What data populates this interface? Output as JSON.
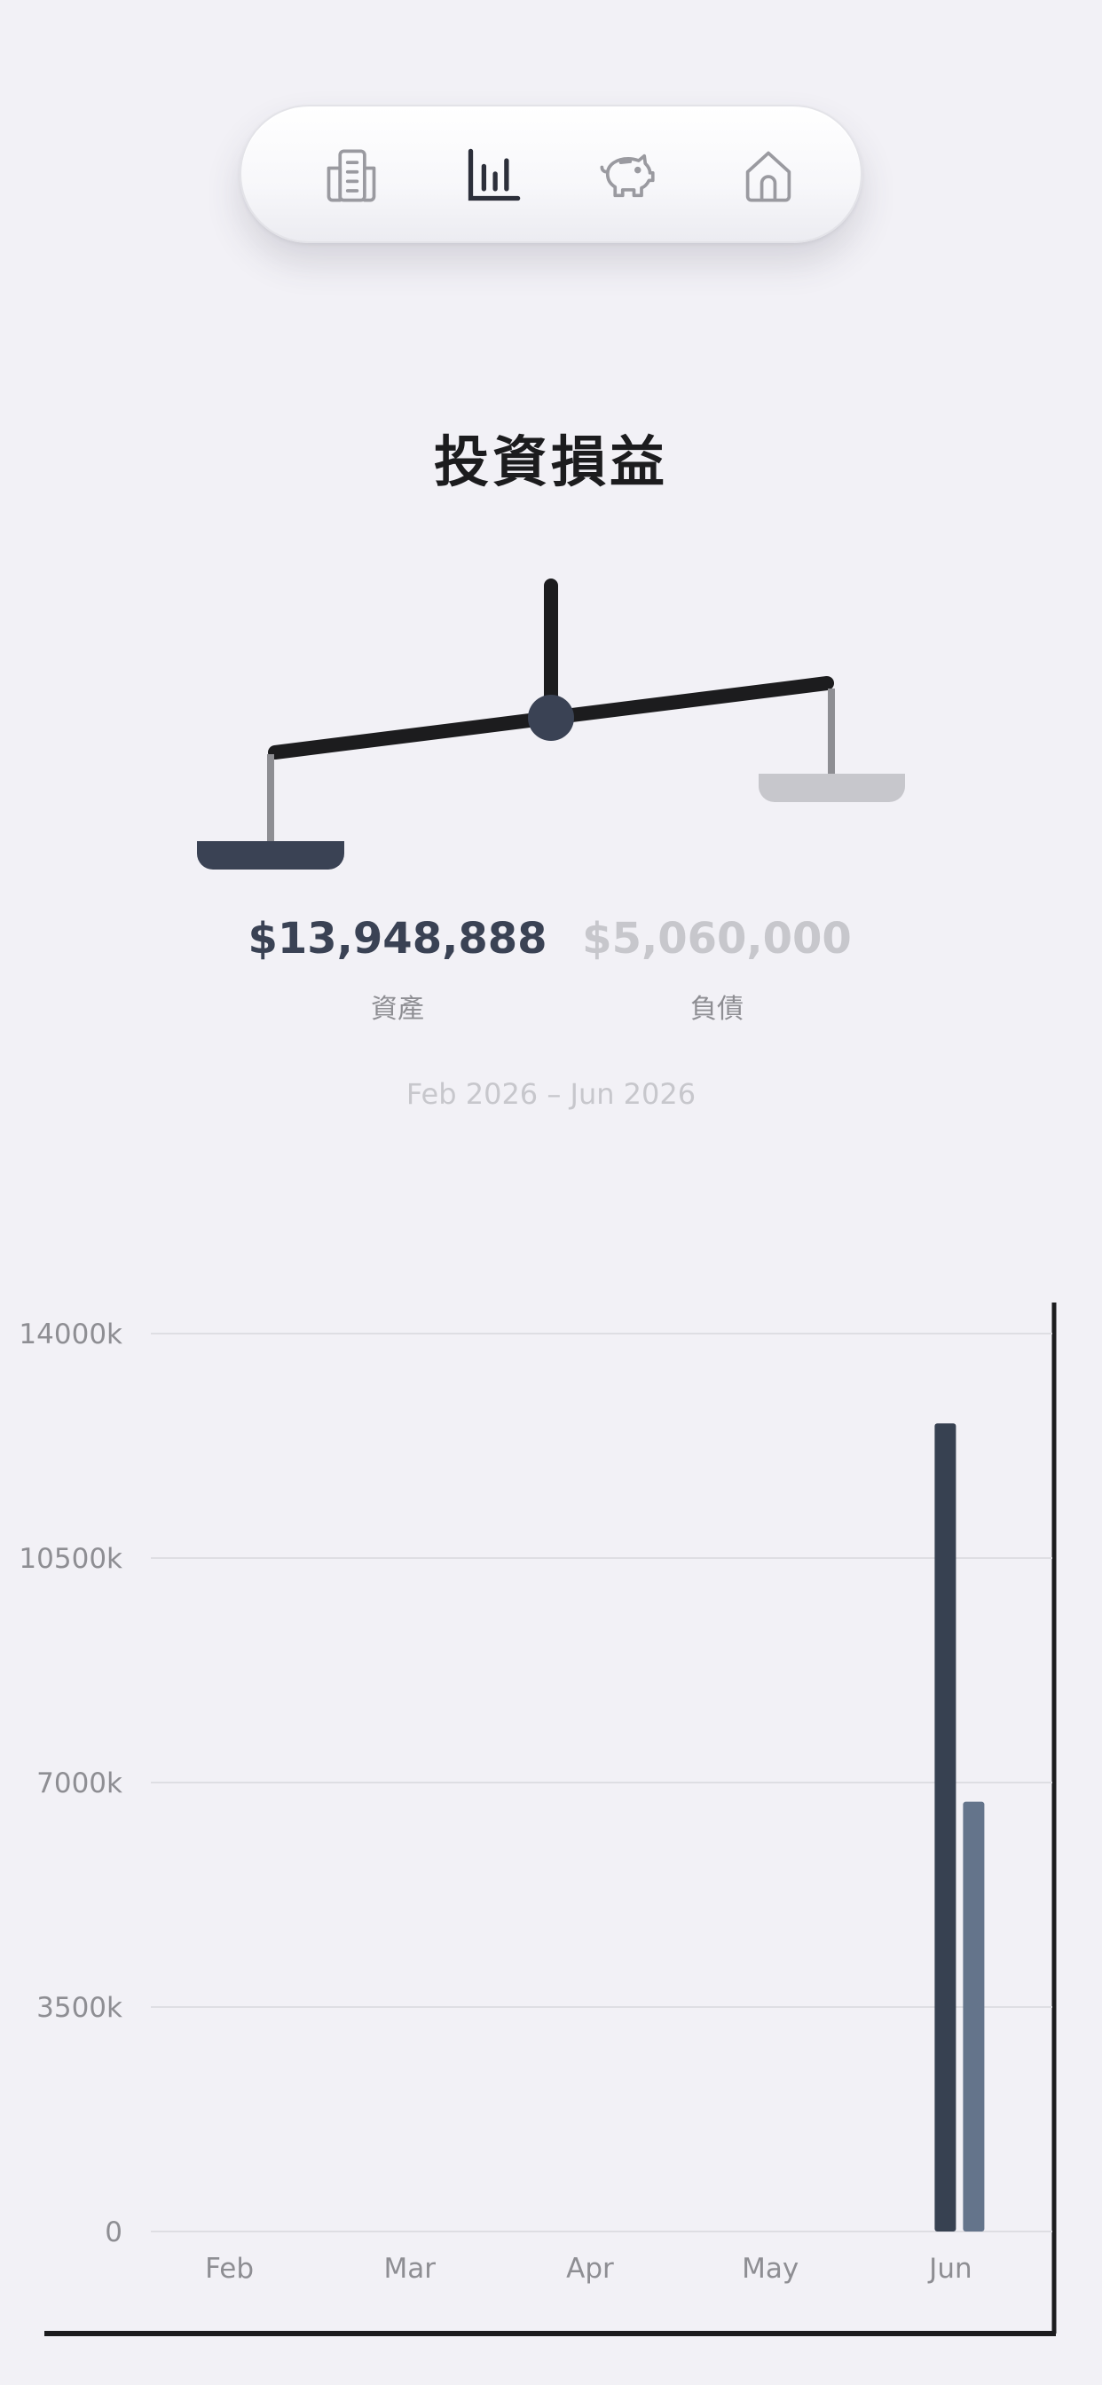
{
  "nav": {
    "items": [
      {
        "name": "building-icon",
        "label": ""
      },
      {
        "name": "bar-chart-icon",
        "label": "",
        "active": true
      },
      {
        "name": "piggy-bank-icon",
        "label": ""
      },
      {
        "name": "home-icon",
        "label": ""
      }
    ],
    "active_color": "#2c2f3a",
    "inactive_color": "#9a9aa0"
  },
  "header": {
    "title": "投資損益"
  },
  "summary": {
    "assets_amount": "$13,948,888",
    "assets_label": "資產",
    "liabilities_amount": "$5,060,000",
    "liabilities_label": "負債",
    "date_range": "Feb 2026 – Jun 2026"
  },
  "colors": {
    "assets": "#3a4254",
    "liabilities": "#c7c7cc",
    "bar_primary": "#374151",
    "bar_secondary": "#64748b",
    "background": "#f2f1f6"
  },
  "chart_data": {
    "type": "bar",
    "categories": [
      "Feb",
      "Mar",
      "Apr",
      "May",
      "Jun"
    ],
    "y_tick_labels": [
      "0",
      "3500k",
      "7000k",
      "10500k",
      "14000k"
    ],
    "y_ticks": [
      0,
      3500000,
      7000000,
      10500000,
      14000000
    ],
    "ylim": [
      0,
      14000000
    ],
    "grid": true,
    "series": [
      {
        "name": "",
        "values": [
          0,
          0,
          0,
          0,
          12600000
        ],
        "color": "#374151"
      },
      {
        "name": "",
        "values": [
          0,
          0,
          0,
          0,
          6700000
        ],
        "color": "#64748b"
      }
    ]
  }
}
